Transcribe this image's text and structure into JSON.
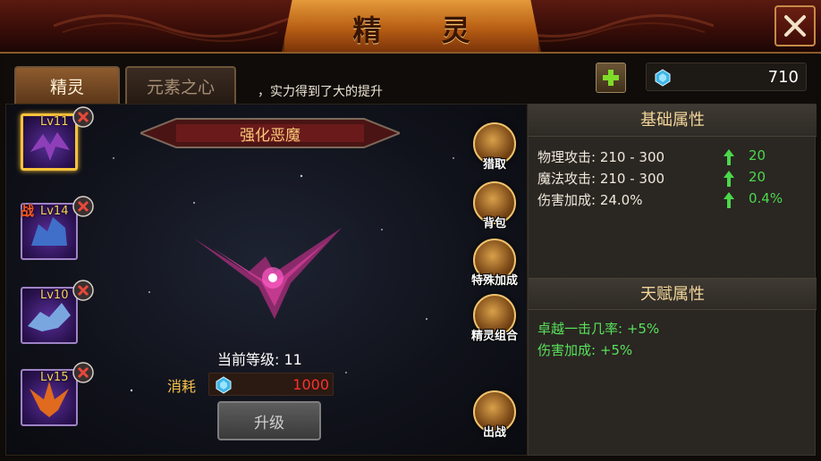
{
  "header": {
    "title": "精 灵"
  },
  "tabs": [
    {
      "label": "精灵",
      "active": true
    },
    {
      "label": "元素之心",
      "active": false
    }
  ],
  "marquee": "，实力得到了大的提升",
  "currency": {
    "icon": "blue-gem-icon",
    "amount": "710"
  },
  "spirits": [
    {
      "level": "Lv11",
      "selected": true,
      "badge": "",
      "color": "#8e3fb8"
    },
    {
      "level": "Lv14",
      "selected": false,
      "badge": "战",
      "color": "#3f6fc8"
    },
    {
      "level": "Lv10",
      "selected": false,
      "badge": "",
      "color": "#7aa6e0"
    },
    {
      "level": "Lv15",
      "selected": false,
      "badge": "",
      "color": "#e06a1e"
    }
  ],
  "selected_spirit": {
    "name": "强化恶魔"
  },
  "side_buttons": [
    {
      "label": "猎取",
      "icon": "cage-icon"
    },
    {
      "label": "背包",
      "icon": "chest-icon"
    },
    {
      "label": "特殊加成",
      "icon": "arrow-up-icon"
    },
    {
      "label": "精灵组合",
      "icon": "demon-head-icon"
    },
    {
      "label": "出战",
      "icon": "crossed-swords-icon"
    }
  ],
  "level_line": "当前等级: 11",
  "cost": {
    "label": "消耗",
    "value": "1000"
  },
  "upgrade_button": "升级",
  "base_attributes": {
    "title": "基础属性",
    "rows": [
      {
        "label": "物理攻击: 210 - 300",
        "gain": "20"
      },
      {
        "label": "魔法攻击: 210 - 300",
        "gain": "20"
      },
      {
        "label": "伤害加成: 24.0%",
        "gain": "0.4%"
      }
    ]
  },
  "talent_attributes": {
    "title": "天赋属性",
    "rows": [
      {
        "label": "卓越一击几率: +5%"
      },
      {
        "label": "伤害加成: +5%"
      }
    ]
  },
  "colors": {
    "accent": "#f7c23b",
    "gain": "#4bd84b",
    "cost": "#ff2f2f",
    "talent": "#57e25a"
  }
}
